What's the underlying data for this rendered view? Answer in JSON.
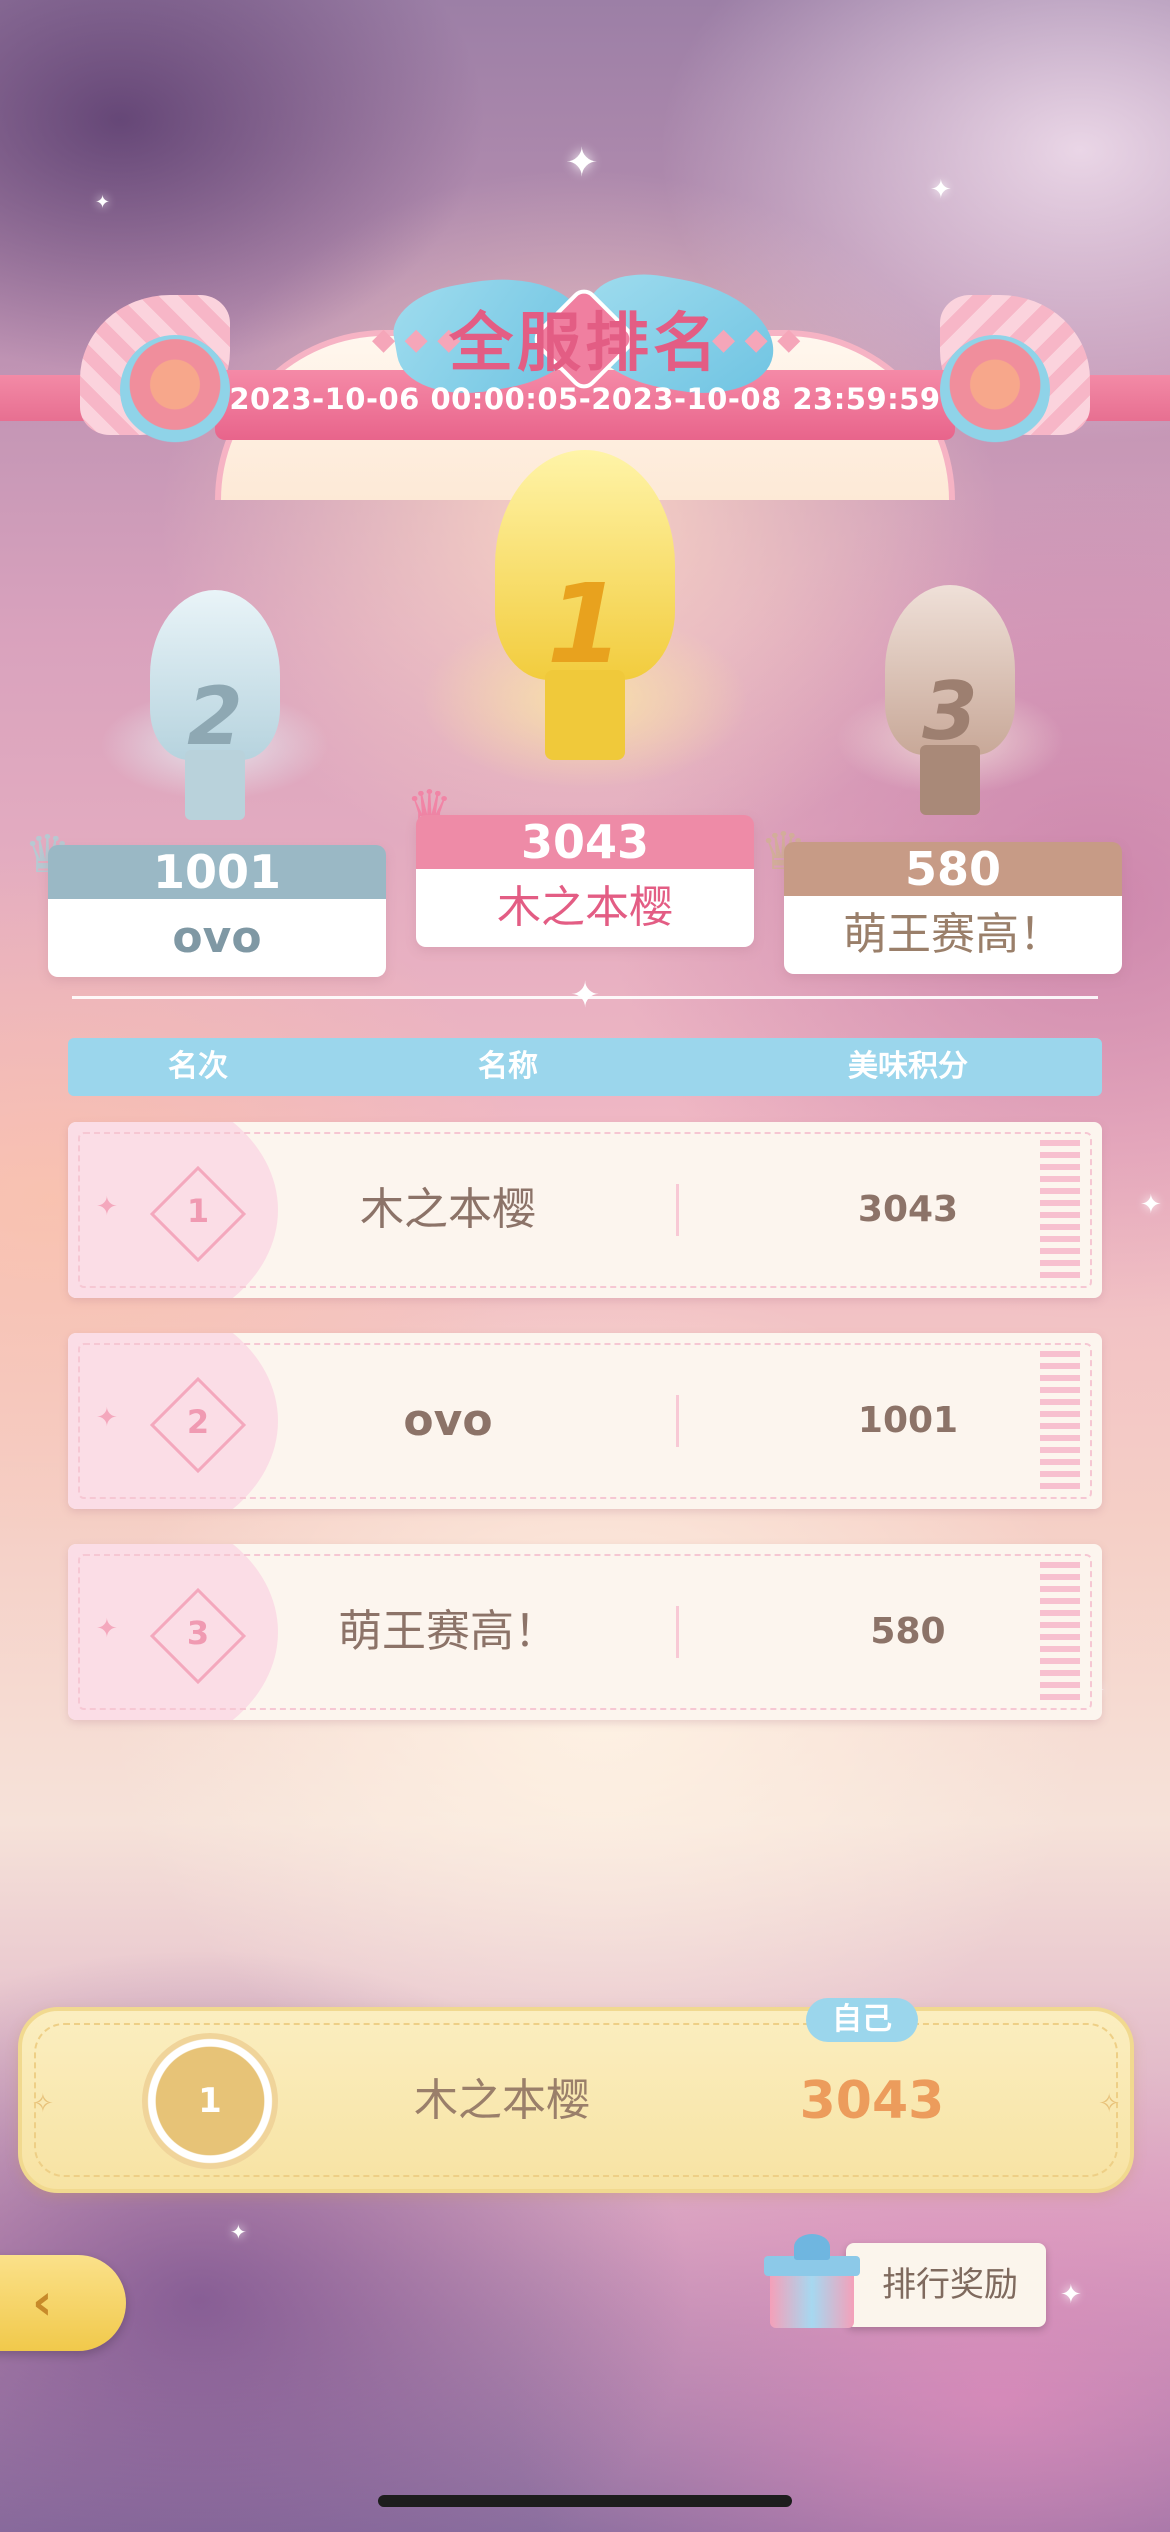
{
  "header": {
    "title": "全服排名",
    "date_range": "2023-10-06 00:00:05-2023-10-08 23:59:59"
  },
  "podium": [
    {
      "rank": "2",
      "score": "1001",
      "name": "ovo"
    },
    {
      "rank": "1",
      "score": "3043",
      "name": "木之本樱"
    },
    {
      "rank": "3",
      "score": "580",
      "name": "萌王赛高！"
    }
  ],
  "table": {
    "headers": {
      "rank": "名次",
      "name": "名称",
      "score": "美味积分"
    },
    "rows": [
      {
        "rank": "1",
        "name": "木之本樱",
        "score": "3043"
      },
      {
        "rank": "2",
        "name": "ovo",
        "score": "1001"
      },
      {
        "rank": "3",
        "name": "萌王赛高！",
        "score": "580"
      }
    ]
  },
  "self": {
    "badge": "自己",
    "rank": "1",
    "name": "木之本樱",
    "score": "3043"
  },
  "controls": {
    "reward_label": "排行奖励"
  },
  "colors": {
    "gold": "#f4cf4a",
    "silver": "#9ab8c5",
    "bronze": "#c79b86",
    "accent_pink": "#e35d84",
    "header_blue": "#9bd6ec"
  },
  "icons": [
    "crown-icon",
    "trophy-icon",
    "back-arrow-icon",
    "gift-icon",
    "sparkle-icon"
  ]
}
